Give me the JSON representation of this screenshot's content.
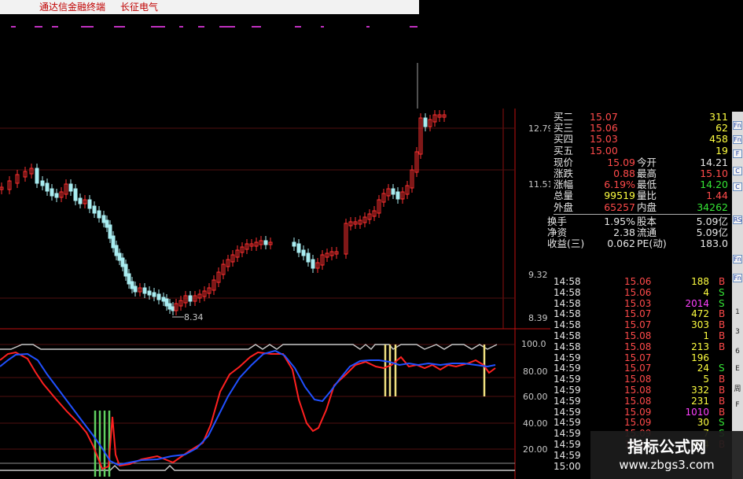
{
  "window": {
    "app_title": "通达信金融终端",
    "stock_name": "长征电气"
  },
  "price_axis": {
    "labels": [
      "12.79",
      "11.51",
      "9.32",
      "8.39"
    ]
  },
  "low_marker": "8.34",
  "indicator_axis": {
    "labels": [
      "100.0",
      "80.00",
      "60.00",
      "40.00",
      "20.00"
    ]
  },
  "quote_panel": {
    "bids": [
      {
        "label": "买二",
        "price": "15.07",
        "vol": "311"
      },
      {
        "label": "买三",
        "price": "15.06",
        "vol": "62"
      },
      {
        "label": "买四",
        "price": "15.03",
        "vol": "458"
      },
      {
        "label": "买五",
        "price": "15.00",
        "vol": "19"
      }
    ],
    "stats": [
      {
        "l1": "现价",
        "v1": "15.09",
        "l2": "今开",
        "v2": "14.21"
      },
      {
        "l1": "涨跌",
        "v1": "0.88",
        "l2": "最高",
        "v2": "15.10"
      },
      {
        "l1": "涨幅",
        "v1": "6.19%",
        "l2": "最低",
        "v2": "14.20"
      },
      {
        "l1": "总量",
        "v1": "99519",
        "l2": "量比",
        "v2": "1.44"
      },
      {
        "l1": "外盘",
        "v1": "65257",
        "l2": "内盘",
        "v2": "34262"
      }
    ],
    "extra": [
      {
        "l1": "换手",
        "v1": "1.95%",
        "l2": "股本",
        "v2": "5.09亿"
      },
      {
        "l1": "净资",
        "v1": "2.38",
        "l2": "流通",
        "v2": "5.09亿"
      },
      {
        "l1": "收益(三)",
        "v1": "0.062",
        "l2": "PE(动)",
        "v2": "183.0"
      }
    ]
  },
  "ticks": [
    {
      "time": "14:58",
      "price": "15.06",
      "vol": "188",
      "side": "B"
    },
    {
      "time": "14:58",
      "price": "15.06",
      "vol": "4",
      "side": "S"
    },
    {
      "time": "14:58",
      "price": "15.03",
      "vol": "2014",
      "side": "S"
    },
    {
      "time": "14:58",
      "price": "15.07",
      "vol": "472",
      "side": "B"
    },
    {
      "time": "14:58",
      "price": "15.07",
      "vol": "303",
      "side": "B"
    },
    {
      "time": "14:58",
      "price": "15.08",
      "vol": "1",
      "side": "B"
    },
    {
      "time": "14:58",
      "price": "15.08",
      "vol": "213",
      "side": "B"
    },
    {
      "time": "14:59",
      "price": "15.07",
      "vol": "196",
      "side": ""
    },
    {
      "time": "14:59",
      "price": "15.07",
      "vol": "24",
      "side": "S"
    },
    {
      "time": "14:59",
      "price": "15.08",
      "vol": "5",
      "side": "B"
    },
    {
      "time": "14:59",
      "price": "15.08",
      "vol": "332",
      "side": "B"
    },
    {
      "time": "14:59",
      "price": "15.08",
      "vol": "231",
      "side": "B"
    },
    {
      "time": "14:59",
      "price": "15.09",
      "vol": "1010",
      "side": "B"
    },
    {
      "time": "14:59",
      "price": "15.09",
      "vol": "30",
      "side": "S"
    },
    {
      "time": "14:59",
      "price": "15.09",
      "vol": "7",
      "side": "S"
    },
    {
      "time": "14:59",
      "price": "15.10",
      "vol": "244",
      "side": "B"
    },
    {
      "time": "14:59",
      "price": "",
      "vol": "",
      "side": ""
    },
    {
      "time": "15:00",
      "price": "",
      "vol": "",
      "side": ""
    }
  ],
  "sidebar": {
    "buttons": [
      "Fn",
      "Fn",
      "F",
      "C",
      "C",
      "RS",
      "Fn",
      "Fn"
    ],
    "labels": [
      "1",
      "3",
      "6",
      "E",
      "周",
      "F"
    ]
  },
  "watermark": {
    "line1": "指标公式网",
    "line2": "www.zbgs3.com"
  },
  "colors": {
    "up": "#ff3030",
    "down": "#a8ecf0",
    "k_line": "#ff2020",
    "d_line": "#2050ff",
    "signal_buy": "#60d060",
    "signal_sell": "#f0e080"
  }
}
